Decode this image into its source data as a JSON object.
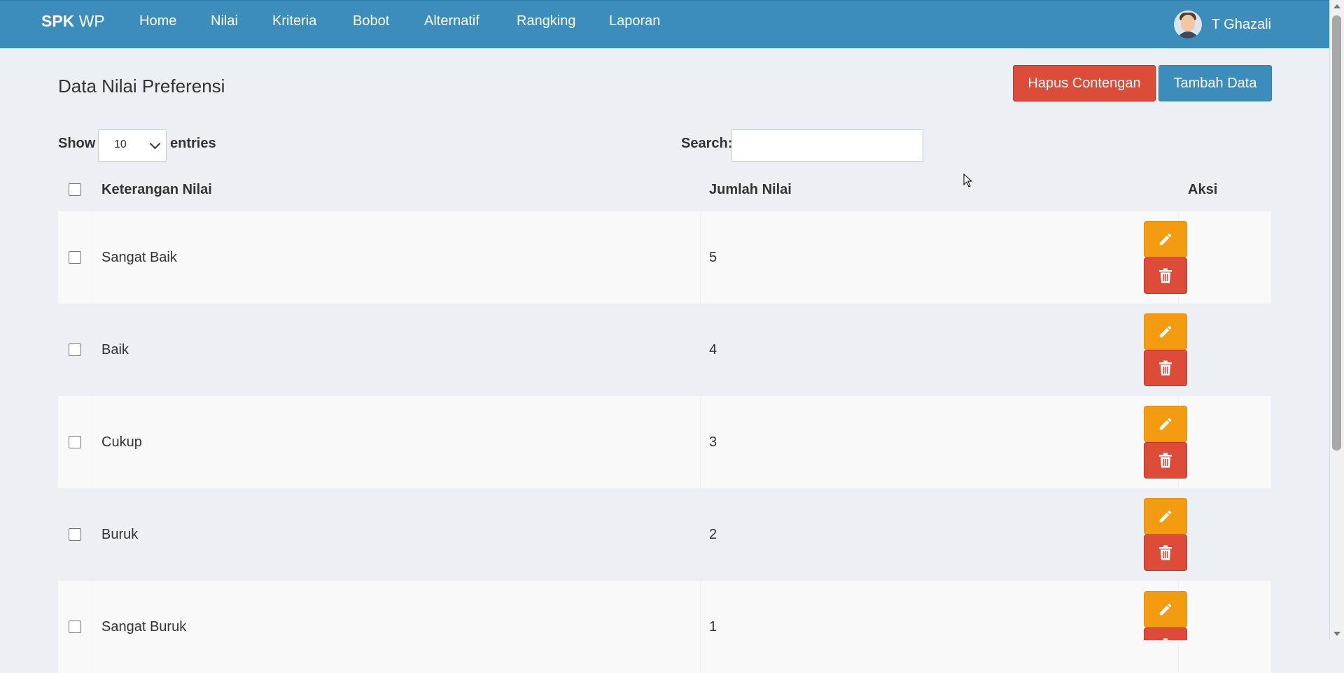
{
  "navbar": {
    "brand_bold": "SPK",
    "brand_rest": "WP",
    "items": [
      "Home",
      "Nilai",
      "Kriteria",
      "Bobot",
      "Alternatif",
      "Rangking",
      "Laporan"
    ],
    "user_name": "T Ghazali",
    "avatar_icon": "user-avatar"
  },
  "page": {
    "title": "Data Nilai Preferensi",
    "delete_checked_label": "Hapus Contengan",
    "add_label": "Tambah Data"
  },
  "controls": {
    "show_label": "Show",
    "entries_value": "10",
    "entries_label": "entries",
    "search_label": "Search:",
    "search_value": ""
  },
  "table": {
    "headers": [
      "Keterangan Nilai",
      "Jumlah Nilai",
      "Aksi"
    ],
    "rows": [
      {
        "keterangan": "Sangat Baik",
        "jumlah": "5"
      },
      {
        "keterangan": "Baik",
        "jumlah": "4"
      },
      {
        "keterangan": "Cukup",
        "jumlah": "3"
      },
      {
        "keterangan": "Buruk",
        "jumlah": "2"
      },
      {
        "keterangan": "Sangat Buruk",
        "jumlah": "1"
      }
    ],
    "edit_icon": "pencil-icon",
    "delete_icon": "trash-icon"
  },
  "colors": {
    "navbar": "#3c8dbc",
    "background": "#ecf0f5",
    "danger": "#dd4b39",
    "primary": "#3c8dbc",
    "warning": "#f39c12"
  }
}
